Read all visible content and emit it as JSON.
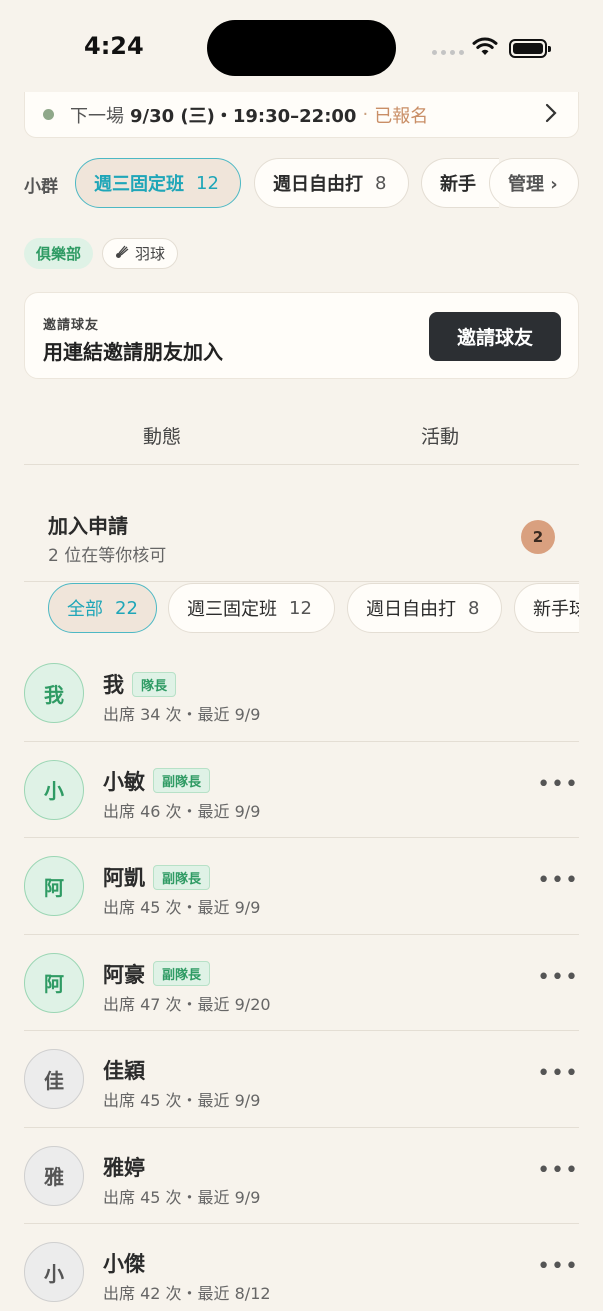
{
  "status_bar": {
    "time": "4:24"
  },
  "next_event": {
    "label": "下一場",
    "when": "9/30 (三)・19:30–22:00",
    "separator": "·",
    "status": "已報名",
    "status_color": "#c98e66"
  },
  "group_bar": {
    "label": "小群",
    "chips": [
      {
        "name": "週三固定班",
        "count": "12"
      },
      {
        "name": "週日自由打",
        "count": "8"
      },
      {
        "name": "新手",
        "count": ""
      }
    ],
    "manage": "管理 ›"
  },
  "tags": {
    "club": "俱樂部",
    "sport": "羽球"
  },
  "invite": {
    "small": "邀請球友",
    "big": "用連結邀請朋友加入",
    "button": "邀請球友"
  },
  "tabs": [
    "動態",
    "活動"
  ],
  "join_request": {
    "title": "加入申請",
    "subtitle": "2 位在等你核可",
    "badge": "2"
  },
  "filters": [
    {
      "name": "全部",
      "count": "22"
    },
    {
      "name": "週三固定班",
      "count": "12"
    },
    {
      "name": "週日自由打",
      "count": "8"
    },
    {
      "name": "新手球",
      "count": ""
    }
  ],
  "members": [
    {
      "avatar": "我",
      "name": "我",
      "role": "隊長",
      "stats": "出席 34 次・最近 9/9",
      "more": "",
      "style": "green"
    },
    {
      "avatar": "小",
      "name": "小敏",
      "role": "副隊長",
      "stats": "出席 46 次・最近 9/9",
      "more": "•••",
      "style": "green"
    },
    {
      "avatar": "阿",
      "name": "阿凱",
      "role": "副隊長",
      "stats": "出席 45 次・最近 9/9",
      "more": "•••",
      "style": "green"
    },
    {
      "avatar": "阿",
      "name": "阿豪",
      "role": "副隊長",
      "stats": "出席 47 次・最近 9/20",
      "more": "•••",
      "style": "green"
    },
    {
      "avatar": "佳",
      "name": "佳穎",
      "role": "",
      "stats": "出席 45 次・最近 9/9",
      "more": "•••",
      "style": "grey"
    },
    {
      "avatar": "雅",
      "name": "雅婷",
      "role": "",
      "stats": "出席 45 次・最近 9/9",
      "more": "•••",
      "style": "grey"
    },
    {
      "avatar": "小",
      "name": "小傑",
      "role": "",
      "stats": "出席 42 次・最近 8/12",
      "more": "•••",
      "style": "grey"
    }
  ],
  "colors": {
    "accent": "#1fa6b8",
    "leader_green": "#2f9b64",
    "badge": "#d9a07f",
    "background": "#f7f3ec"
  }
}
